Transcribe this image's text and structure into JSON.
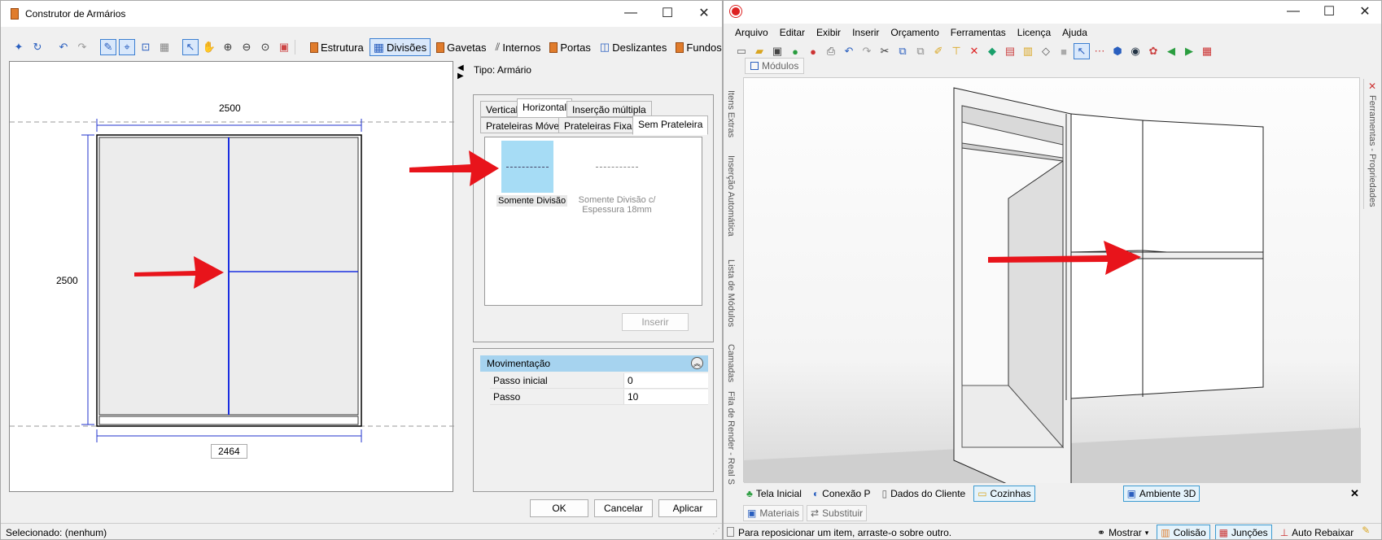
{
  "left_window": {
    "title": "Construtor de Armários",
    "toolbar_tabs": [
      "Estrutura",
      "Divisões",
      "Gavetas",
      "Internos",
      "Portas",
      "Deslizantes",
      "Fundos"
    ],
    "selected_tab": "Divisões",
    "type_label": "Tipo: Armário",
    "drawing": {
      "top_dim": "2500",
      "left_dim": "2500",
      "bottom_dim": "2464"
    },
    "division_tabs_row1": [
      "Vertical",
      "Horizontal",
      "Inserção múltipla"
    ],
    "division_tabs_row2": [
      "Prateleiras Móveis",
      "Prateleiras Fixas",
      "Sem Prateleira"
    ],
    "options": [
      {
        "label": "Somente Divisão"
      },
      {
        "label": "Somente Divisão c/ Espessura 18mm"
      }
    ],
    "insert_button": "Inserir",
    "movement": {
      "title": "Movimentação",
      "rows": [
        {
          "label": "Passo inicial",
          "value": "0"
        },
        {
          "label": "Passo",
          "value": "10"
        }
      ]
    },
    "buttons": {
      "ok": "OK",
      "cancel": "Cancelar",
      "apply": "Aplicar"
    },
    "status": "Selecionado: (nenhum)"
  },
  "right_window": {
    "menu": [
      "Arquivo",
      "Editar",
      "Exibir",
      "Inserir",
      "Orçamento",
      "Ferramentas",
      "Licença",
      "Ajuda"
    ],
    "modules_tab": "Módulos",
    "side_tabs_left": [
      "Itens Extras",
      "Inserção Automática",
      "Lista de Módulos",
      "Camadas",
      "Fila de Render - Real S"
    ],
    "side_tab_right": "Ferramentas - Propriedades",
    "bottom_tabs": [
      "Tela Inicial",
      "Conexão P",
      "Dados do Cliente",
      "Cozinhas",
      "Ambiente 3D"
    ],
    "lower_tabs": [
      "Materiais",
      "Substituir"
    ],
    "status": "Para reposicionar um item, arraste-o sobre outro.",
    "status_buttons": [
      "Mostrar",
      "Colisão",
      "Junções",
      "Auto Rebaixar"
    ]
  },
  "colors": {
    "accent": "#3c7fd1",
    "arrow": "#e8141b",
    "selected_option": "#a6dcf5"
  }
}
